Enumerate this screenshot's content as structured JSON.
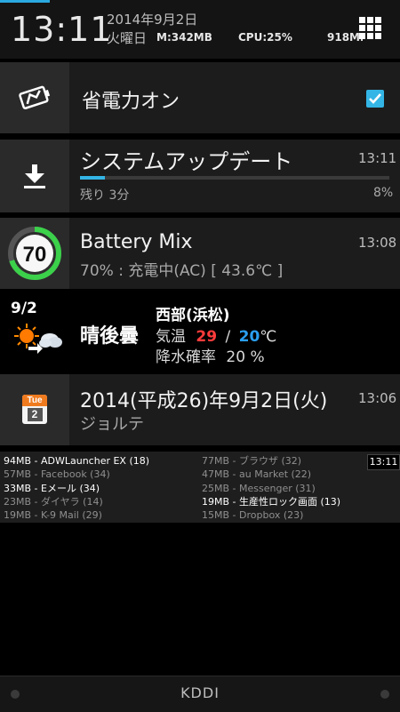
{
  "header": {
    "time": "13:11",
    "date": "2014年9月2日",
    "weekday": "火曜日",
    "memory": "M:342MB",
    "cpu": "CPU:25%",
    "battery": "918MH"
  },
  "power_saver": {
    "label": "省電力オン",
    "checked": true
  },
  "system_update": {
    "title": "システムアップデート",
    "time": "13:11",
    "remaining": "残り 3分",
    "percent_label": "8%",
    "progress": 0.08
  },
  "battery_mix": {
    "title": "Battery Mix",
    "time": "13:08",
    "detail": "70% : 充電中(AC) [ 43.6℃ ]",
    "level": "70"
  },
  "weather": {
    "date": "9/2",
    "forecast": "晴後曇",
    "region": "西部(浜松)",
    "temp_label": "気温",
    "temp_high": "29",
    "temp_sep": "/",
    "temp_low": "20",
    "temp_unit": "℃",
    "rain_label": "降水確率",
    "rain_value": "20 %"
  },
  "calendar": {
    "icon_day": "Tue",
    "icon_date": "2",
    "title": "2014(平成26)年9月2日(火)",
    "time": "13:06",
    "sub": "ジョルテ"
  },
  "tasks": {
    "time": "13:11",
    "left": [
      "94MB - ADWLauncher EX (18)",
      "57MB - Facebook (34)",
      "33MB - Eメール (34)",
      "23MB - ダイヤラ (14)",
      "19MB - K-9 Mail (29)"
    ],
    "right": [
      "77MB - ブラウザ (32)",
      "47MB - au Market (22)",
      "25MB - Messenger (31)",
      "19MB - 生産性ロック画面 (13)",
      "15MB - Dropbox (23)"
    ]
  },
  "footer": {
    "carrier": "KDDI"
  },
  "colors": {
    "accent": "#33b5e5",
    "battery_ring": "#3bd14a",
    "temp_high": "#ff3b3b",
    "temp_low": "#2a9ff0"
  }
}
